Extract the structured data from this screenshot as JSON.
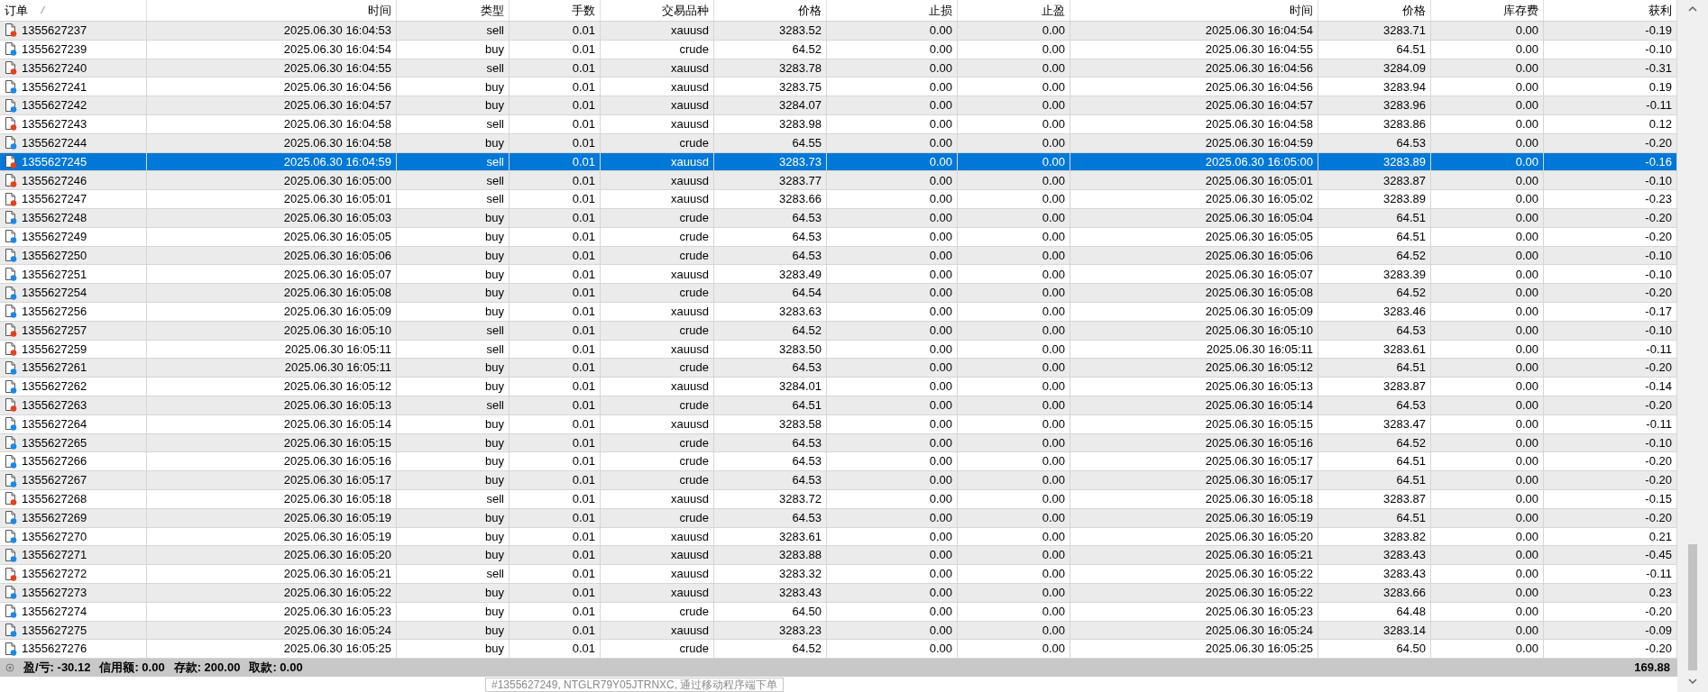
{
  "table": {
    "columns": [
      {
        "label": "订单",
        "sort": "⁄"
      },
      {
        "label": "时间"
      },
      {
        "label": "类型"
      },
      {
        "label": "手数"
      },
      {
        "label": "交易品种"
      },
      {
        "label": "价格"
      },
      {
        "label": "止损"
      },
      {
        "label": "止盈"
      },
      {
        "label": "时间"
      },
      {
        "label": "价格"
      },
      {
        "label": "库存费"
      },
      {
        "label": "获利"
      }
    ],
    "rows": [
      {
        "kind": "sell",
        "selected": false,
        "cells": [
          "1355627237",
          "2025.06.30 16:04:53",
          "sell",
          "0.01",
          "xauusd",
          "3283.52",
          "0.00",
          "0.00",
          "2025.06.30 16:04:54",
          "3283.71",
          "0.00",
          "-0.19"
        ]
      },
      {
        "kind": "buy",
        "selected": false,
        "cells": [
          "1355627239",
          "2025.06.30 16:04:54",
          "buy",
          "0.01",
          "crude",
          "64.52",
          "0.00",
          "0.00",
          "2025.06.30 16:04:55",
          "64.51",
          "0.00",
          "-0.10"
        ]
      },
      {
        "kind": "sell",
        "selected": false,
        "cells": [
          "1355627240",
          "2025.06.30 16:04:55",
          "sell",
          "0.01",
          "xauusd",
          "3283.78",
          "0.00",
          "0.00",
          "2025.06.30 16:04:56",
          "3284.09",
          "0.00",
          "-0.31"
        ]
      },
      {
        "kind": "buy",
        "selected": false,
        "cells": [
          "1355627241",
          "2025.06.30 16:04:56",
          "buy",
          "0.01",
          "xauusd",
          "3283.75",
          "0.00",
          "0.00",
          "2025.06.30 16:04:56",
          "3283.94",
          "0.00",
          "0.19"
        ]
      },
      {
        "kind": "buy",
        "selected": false,
        "cells": [
          "1355627242",
          "2025.06.30 16:04:57",
          "buy",
          "0.01",
          "xauusd",
          "3284.07",
          "0.00",
          "0.00",
          "2025.06.30 16:04:57",
          "3283.96",
          "0.00",
          "-0.11"
        ]
      },
      {
        "kind": "sell",
        "selected": false,
        "cells": [
          "1355627243",
          "2025.06.30 16:04:58",
          "sell",
          "0.01",
          "xauusd",
          "3283.98",
          "0.00",
          "0.00",
          "2025.06.30 16:04:58",
          "3283.86",
          "0.00",
          "0.12"
        ]
      },
      {
        "kind": "buy",
        "selected": false,
        "cells": [
          "1355627244",
          "2025.06.30 16:04:58",
          "buy",
          "0.01",
          "crude",
          "64.55",
          "0.00",
          "0.00",
          "2025.06.30 16:04:59",
          "64.53",
          "0.00",
          "-0.20"
        ]
      },
      {
        "kind": "sell",
        "selected": true,
        "cells": [
          "1355627245",
          "2025.06.30 16:04:59",
          "sell",
          "0.01",
          "xauusd",
          "3283.73",
          "0.00",
          "0.00",
          "2025.06.30 16:05:00",
          "3283.89",
          "0.00",
          "-0.16"
        ]
      },
      {
        "kind": "sell",
        "selected": false,
        "cells": [
          "1355627246",
          "2025.06.30 16:05:00",
          "sell",
          "0.01",
          "xauusd",
          "3283.77",
          "0.00",
          "0.00",
          "2025.06.30 16:05:01",
          "3283.87",
          "0.00",
          "-0.10"
        ]
      },
      {
        "kind": "sell",
        "selected": false,
        "cells": [
          "1355627247",
          "2025.06.30 16:05:01",
          "sell",
          "0.01",
          "xauusd",
          "3283.66",
          "0.00",
          "0.00",
          "2025.06.30 16:05:02",
          "3283.89",
          "0.00",
          "-0.23"
        ]
      },
      {
        "kind": "buy",
        "selected": false,
        "cells": [
          "1355627248",
          "2025.06.30 16:05:03",
          "buy",
          "0.01",
          "crude",
          "64.53",
          "0.00",
          "0.00",
          "2025.06.30 16:05:04",
          "64.51",
          "0.00",
          "-0.20"
        ]
      },
      {
        "kind": "buy",
        "selected": false,
        "cells": [
          "1355627249",
          "2025.06.30 16:05:05",
          "buy",
          "0.01",
          "crude",
          "64.53",
          "0.00",
          "0.00",
          "2025.06.30 16:05:05",
          "64.51",
          "0.00",
          "-0.20"
        ]
      },
      {
        "kind": "buy",
        "selected": false,
        "cells": [
          "1355627250",
          "2025.06.30 16:05:06",
          "buy",
          "0.01",
          "crude",
          "64.53",
          "0.00",
          "0.00",
          "2025.06.30 16:05:06",
          "64.52",
          "0.00",
          "-0.10"
        ]
      },
      {
        "kind": "buy",
        "selected": false,
        "cells": [
          "1355627251",
          "2025.06.30 16:05:07",
          "buy",
          "0.01",
          "xauusd",
          "3283.49",
          "0.00",
          "0.00",
          "2025.06.30 16:05:07",
          "3283.39",
          "0.00",
          "-0.10"
        ]
      },
      {
        "kind": "buy",
        "selected": false,
        "cells": [
          "1355627254",
          "2025.06.30 16:05:08",
          "buy",
          "0.01",
          "crude",
          "64.54",
          "0.00",
          "0.00",
          "2025.06.30 16:05:08",
          "64.52",
          "0.00",
          "-0.20"
        ]
      },
      {
        "kind": "buy",
        "selected": false,
        "cells": [
          "1355627256",
          "2025.06.30 16:05:09",
          "buy",
          "0.01",
          "xauusd",
          "3283.63",
          "0.00",
          "0.00",
          "2025.06.30 16:05:09",
          "3283.46",
          "0.00",
          "-0.17"
        ]
      },
      {
        "kind": "sell",
        "selected": false,
        "cells": [
          "1355627257",
          "2025.06.30 16:05:10",
          "sell",
          "0.01",
          "crude",
          "64.52",
          "0.00",
          "0.00",
          "2025.06.30 16:05:10",
          "64.53",
          "0.00",
          "-0.10"
        ]
      },
      {
        "kind": "sell",
        "selected": false,
        "cells": [
          "1355627259",
          "2025.06.30 16:05:11",
          "sell",
          "0.01",
          "xauusd",
          "3283.50",
          "0.00",
          "0.00",
          "2025.06.30 16:05:11",
          "3283.61",
          "0.00",
          "-0.11"
        ]
      },
      {
        "kind": "buy",
        "selected": false,
        "cells": [
          "1355627261",
          "2025.06.30 16:05:11",
          "buy",
          "0.01",
          "crude",
          "64.53",
          "0.00",
          "0.00",
          "2025.06.30 16:05:12",
          "64.51",
          "0.00",
          "-0.20"
        ]
      },
      {
        "kind": "buy",
        "selected": false,
        "cells": [
          "1355627262",
          "2025.06.30 16:05:12",
          "buy",
          "0.01",
          "xauusd",
          "3284.01",
          "0.00",
          "0.00",
          "2025.06.30 16:05:13",
          "3283.87",
          "0.00",
          "-0.14"
        ]
      },
      {
        "kind": "sell",
        "selected": false,
        "cells": [
          "1355627263",
          "2025.06.30 16:05:13",
          "sell",
          "0.01",
          "crude",
          "64.51",
          "0.00",
          "0.00",
          "2025.06.30 16:05:14",
          "64.53",
          "0.00",
          "-0.20"
        ]
      },
      {
        "kind": "buy",
        "selected": false,
        "cells": [
          "1355627264",
          "2025.06.30 16:05:14",
          "buy",
          "0.01",
          "xauusd",
          "3283.58",
          "0.00",
          "0.00",
          "2025.06.30 16:05:15",
          "3283.47",
          "0.00",
          "-0.11"
        ]
      },
      {
        "kind": "buy",
        "selected": false,
        "cells": [
          "1355627265",
          "2025.06.30 16:05:15",
          "buy",
          "0.01",
          "crude",
          "64.53",
          "0.00",
          "0.00",
          "2025.06.30 16:05:16",
          "64.52",
          "0.00",
          "-0.10"
        ]
      },
      {
        "kind": "buy",
        "selected": false,
        "cells": [
          "1355627266",
          "2025.06.30 16:05:16",
          "buy",
          "0.01",
          "crude",
          "64.53",
          "0.00",
          "0.00",
          "2025.06.30 16:05:17",
          "64.51",
          "0.00",
          "-0.20"
        ]
      },
      {
        "kind": "buy",
        "selected": false,
        "cells": [
          "1355627267",
          "2025.06.30 16:05:17",
          "buy",
          "0.01",
          "crude",
          "64.53",
          "0.00",
          "0.00",
          "2025.06.30 16:05:17",
          "64.51",
          "0.00",
          "-0.20"
        ]
      },
      {
        "kind": "sell",
        "selected": false,
        "cells": [
          "1355627268",
          "2025.06.30 16:05:18",
          "sell",
          "0.01",
          "xauusd",
          "3283.72",
          "0.00",
          "0.00",
          "2025.06.30 16:05:18",
          "3283.87",
          "0.00",
          "-0.15"
        ]
      },
      {
        "kind": "buy",
        "selected": false,
        "cells": [
          "1355627269",
          "2025.06.30 16:05:19",
          "buy",
          "0.01",
          "crude",
          "64.53",
          "0.00",
          "0.00",
          "2025.06.30 16:05:19",
          "64.51",
          "0.00",
          "-0.20"
        ]
      },
      {
        "kind": "buy",
        "selected": false,
        "cells": [
          "1355627270",
          "2025.06.30 16:05:19",
          "buy",
          "0.01",
          "xauusd",
          "3283.61",
          "0.00",
          "0.00",
          "2025.06.30 16:05:20",
          "3283.82",
          "0.00",
          "0.21"
        ]
      },
      {
        "kind": "buy",
        "selected": false,
        "cells": [
          "1355627271",
          "2025.06.30 16:05:20",
          "buy",
          "0.01",
          "xauusd",
          "3283.88",
          "0.00",
          "0.00",
          "2025.06.30 16:05:21",
          "3283.43",
          "0.00",
          "-0.45"
        ]
      },
      {
        "kind": "sell",
        "selected": false,
        "cells": [
          "1355627272",
          "2025.06.30 16:05:21",
          "sell",
          "0.01",
          "xauusd",
          "3283.32",
          "0.00",
          "0.00",
          "2025.06.30 16:05:22",
          "3283.43",
          "0.00",
          "-0.11"
        ]
      },
      {
        "kind": "buy",
        "selected": false,
        "cells": [
          "1355627273",
          "2025.06.30 16:05:22",
          "buy",
          "0.01",
          "xauusd",
          "3283.43",
          "0.00",
          "0.00",
          "2025.06.30 16:05:22",
          "3283.66",
          "0.00",
          "0.23"
        ]
      },
      {
        "kind": "buy",
        "selected": false,
        "cells": [
          "1355627274",
          "2025.06.30 16:05:23",
          "buy",
          "0.01",
          "crude",
          "64.50",
          "0.00",
          "0.00",
          "2025.06.30 16:05:23",
          "64.48",
          "0.00",
          "-0.20"
        ]
      },
      {
        "kind": "buy",
        "selected": false,
        "cells": [
          "1355627275",
          "2025.06.30 16:05:24",
          "buy",
          "0.01",
          "xauusd",
          "3283.23",
          "0.00",
          "0.00",
          "2025.06.30 16:05:24",
          "3283.14",
          "0.00",
          "-0.09"
        ]
      },
      {
        "kind": "buy",
        "selected": false,
        "cells": [
          "1355627276",
          "2025.06.30 16:05:25",
          "buy",
          "0.01",
          "crude",
          "64.52",
          "0.00",
          "0.00",
          "2025.06.30 16:05:25",
          "64.50",
          "0.00",
          "-0.20"
        ]
      }
    ]
  },
  "tooltip": {
    "text": "#1355627249, NTGLR79Y05JTRNXC, 通过移动程序端下单"
  },
  "status_bar": {
    "items": [
      "盈/亏: -30.12",
      "信用额: 0.00",
      "存款: 200.00",
      "取款: 0.00"
    ],
    "total": "169.88"
  }
}
